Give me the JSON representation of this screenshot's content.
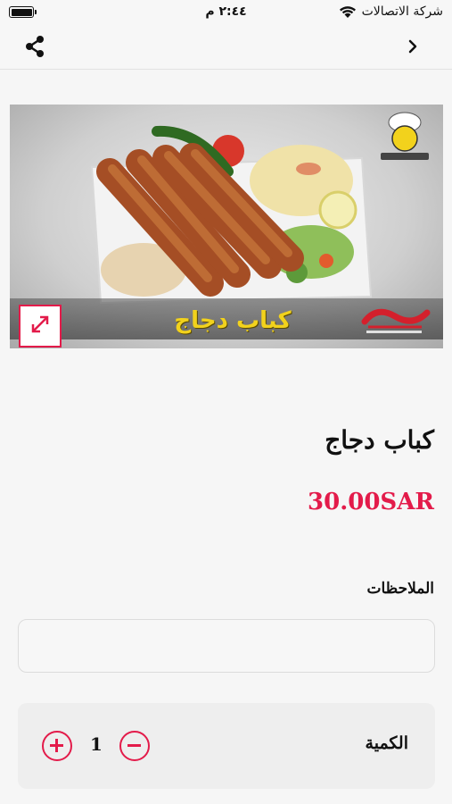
{
  "status_bar": {
    "time": "٢:٤٤ م",
    "carrier": "شركة الاتصالات"
  },
  "nav": {
    "share_icon": "share-icon",
    "back_icon": "chevron-right-icon"
  },
  "image": {
    "caption": "كباب دجاج",
    "expand_icon": "expand-icon"
  },
  "product": {
    "name": "كباب دجاج",
    "price": "30.00SAR"
  },
  "notes": {
    "label": "الملاحظات",
    "value": "",
    "placeholder": ""
  },
  "quantity": {
    "label": "الكمية",
    "value": "1"
  },
  "colors": {
    "accent": "#e31b4a",
    "background": "#f6f6f6"
  }
}
